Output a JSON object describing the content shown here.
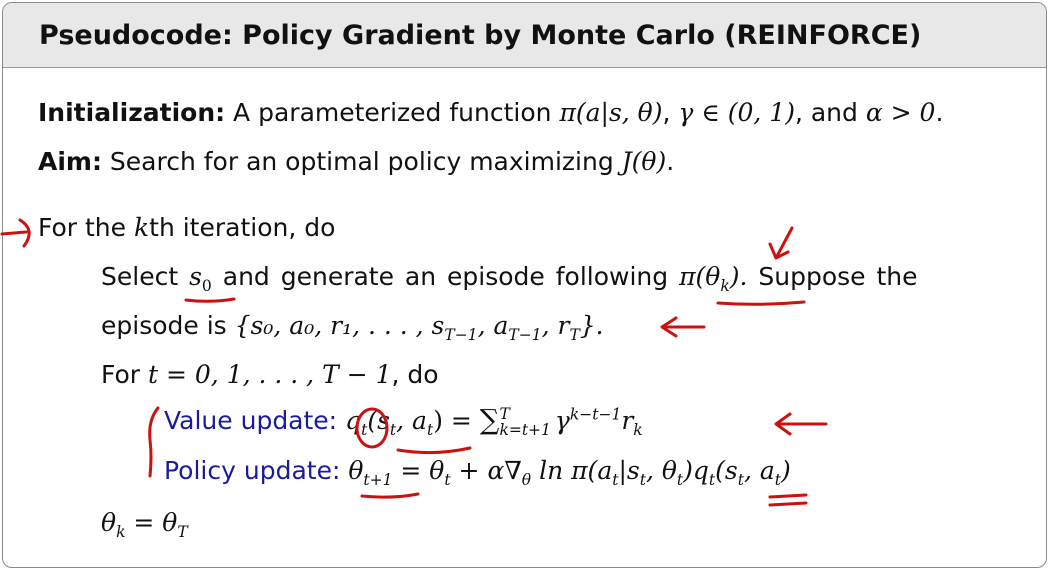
{
  "header": {
    "title": "Pseudocode: Policy Gradient by Monte Carlo (REINFORCE)"
  },
  "init": {
    "label": "Initialization:",
    "text1": " A parameterized function ",
    "func": "π(a|s, θ)",
    "text2": ",  ",
    "gamma": "γ ∈ (0, 1)",
    "text3": ", and ",
    "alpha": "α > 0",
    "text4": "."
  },
  "aim": {
    "label": "Aim:",
    "text": " Search for an optimal policy maximizing ",
    "obj": "J(θ)",
    "end": "."
  },
  "loop": {
    "text1": "For the ",
    "k": "k",
    "text2": "th iteration, do"
  },
  "select": {
    "text1": "Select ",
    "s0": "s",
    "s0sub": "0",
    "text2": " and generate an episode following ",
    "pi": "π(θ",
    "pisub": "k",
    "piend": ").",
    "text3": "  Suppose the"
  },
  "episode": {
    "text1": "episode is ",
    "set": "{s₀, a₀, r₁, . . . , s",
    "sub1": "T−1",
    "mid": ", a",
    "sub2": "T−1",
    "mid2": ", r",
    "sub3": "T",
    "end": "}."
  },
  "for_t": {
    "text1": "For ",
    "range": "t = 0, 1, . . . , T − 1",
    "text2": ", do"
  },
  "value_update": {
    "label": "Value update: ",
    "q": "q",
    "qsub": "t",
    "args": "(s",
    "argsub1": "t",
    "args2": ", a",
    "argsub2": "t",
    "args3": ") = ",
    "sum": "∑",
    "sum_top": "T",
    "sum_bottom": "k=t+1",
    "gamma": "γ",
    "gamma_exp": "k−t−1",
    "r": "r",
    "rsub": "k"
  },
  "policy_update": {
    "label": "Policy update: ",
    "theta": "θ",
    "thetasub": "t+1",
    "eq": " = θ",
    "eqsub": "t",
    "rest1": " + α∇",
    "nablasub": "θ",
    "rest2": " ln π(a",
    "rest2sub": "t",
    "rest3": "|s",
    "rest3sub": "t",
    "rest4": ", θ",
    "rest4sub": "t",
    "rest5": ")q",
    "rest5sub": "t",
    "rest6": "(s",
    "rest6sub": "t",
    "rest7": ", a",
    "rest7sub": "t",
    "rest8": ")"
  },
  "final": {
    "lhs": "θ",
    "lhssub": "k",
    "eq": " = θ",
    "rhssub": "T"
  },
  "colors": {
    "annotation": "#cc1111",
    "update_label": "#1a1aa0",
    "header_bg": "#e8e8e8"
  }
}
